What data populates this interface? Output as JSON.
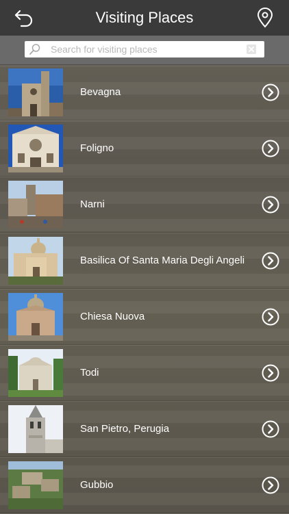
{
  "header": {
    "title": "Visiting Places",
    "back_icon": "back-arrow-icon",
    "map_icon": "map-pin-icon"
  },
  "search": {
    "placeholder": "Search for visiting places",
    "value": ""
  },
  "places": [
    {
      "name": "Bevagna"
    },
    {
      "name": "Foligno"
    },
    {
      "name": "Narni"
    },
    {
      "name": "Basilica Of Santa Maria Degli Angeli"
    },
    {
      "name": "Chiesa Nuova"
    },
    {
      "name": "Todi"
    },
    {
      "name": "San Pietro, Perugia"
    },
    {
      "name": "Gubbio"
    }
  ]
}
